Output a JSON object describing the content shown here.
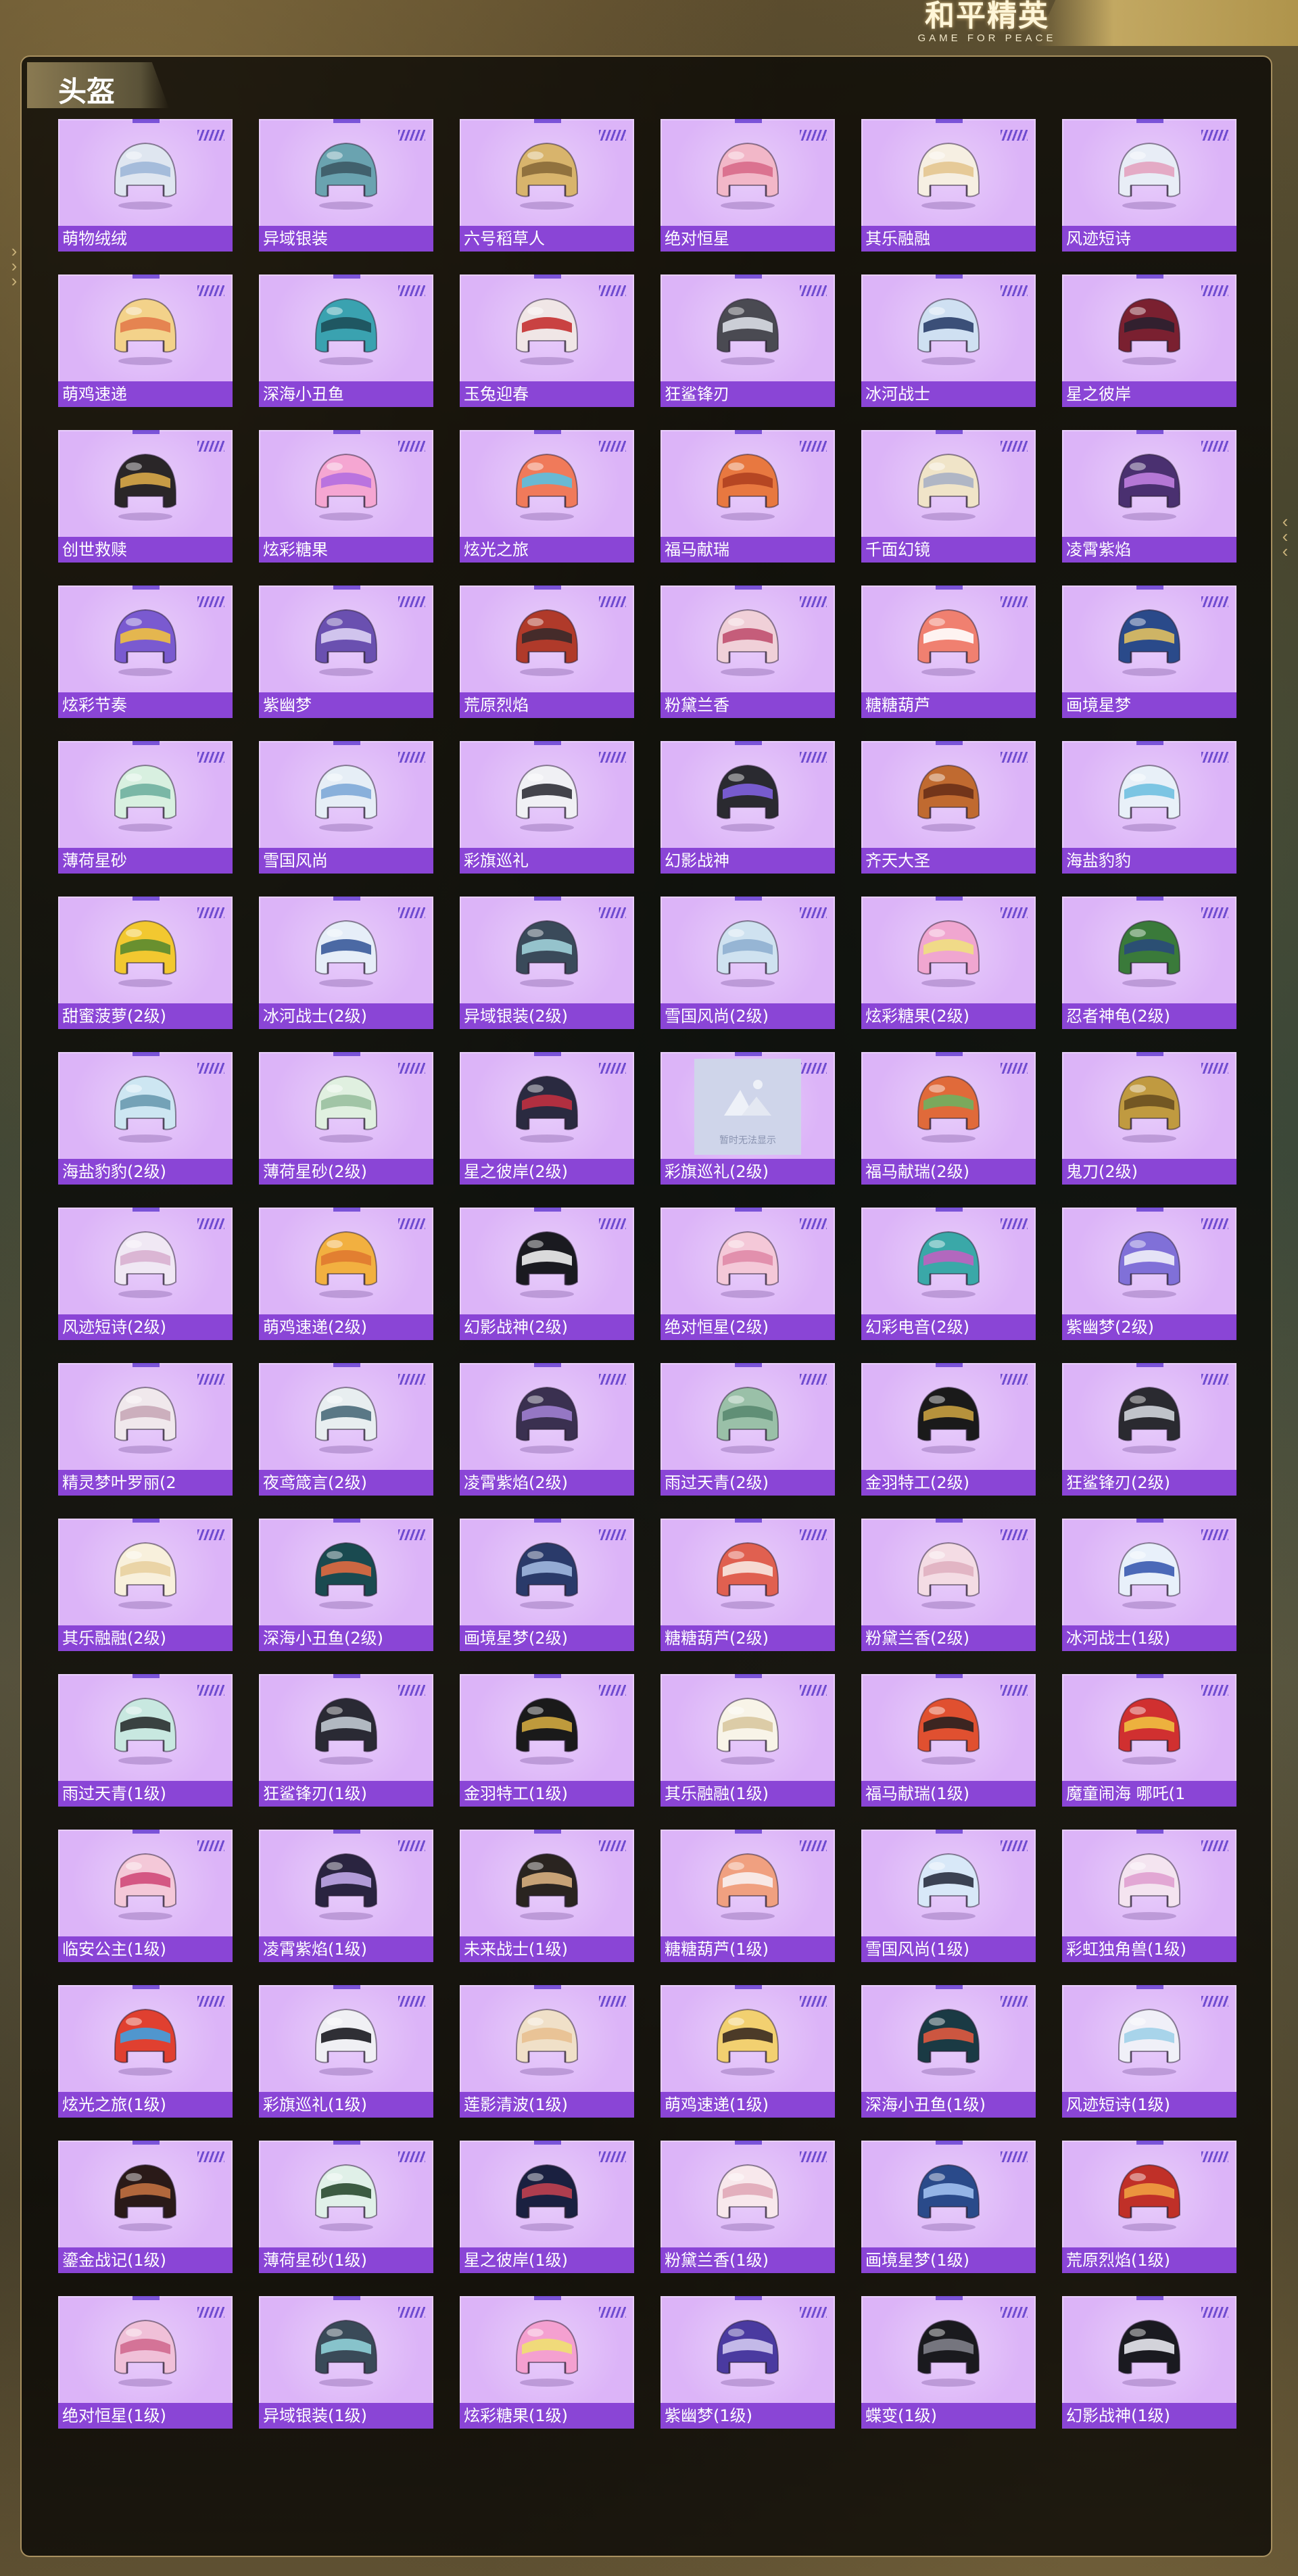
{
  "logo": {
    "title": "和平精英",
    "subtitle": "GAME FOR PEACE"
  },
  "panel": {
    "title": "头盔"
  },
  "placeholder_text": "暂时无法显示",
  "items": [
    {
      "name": "萌物绒绒",
      "color": "#dfe6f0",
      "accent": "#9fb7d8"
    },
    {
      "name": "异域银装",
      "color": "#6aa3b0",
      "accent": "#3d5a66"
    },
    {
      "name": "六号稻草人",
      "color": "#d8b46c",
      "accent": "#8a6a3a"
    },
    {
      "name": "绝对恒星",
      "color": "#f2b7c8",
      "accent": "#d86a8a"
    },
    {
      "name": "其乐融融",
      "color": "#f6efe2",
      "accent": "#e4c590"
    },
    {
      "name": "风迹短诗",
      "color": "#e8edf6",
      "accent": "#e3a2c0"
    },
    {
      "name": "萌鸡速递",
      "color": "#f3d28a",
      "accent": "#e37b4a"
    },
    {
      "name": "深海小丑鱼",
      "color": "#3aa2b0",
      "accent": "#1d4f5a"
    },
    {
      "name": "玉兔迎春",
      "color": "#f0e6e6",
      "accent": "#c43030"
    },
    {
      "name": "狂鲨锋刃",
      "color": "#4a4a52",
      "accent": "#d9dde4"
    },
    {
      "name": "冰河战士",
      "color": "#cfe0f2",
      "accent": "#2a3f6a"
    },
    {
      "name": "星之彼岸",
      "color": "#7a2030",
      "accent": "#2a2030"
    },
    {
      "name": "创世救赎",
      "color": "#2a2628",
      "accent": "#d8a848"
    },
    {
      "name": "炫彩糖果",
      "color": "#f5a6d2",
      "accent": "#b46ee0"
    },
    {
      "name": "炫光之旅",
      "color": "#f07a5a",
      "accent": "#5ac0e0"
    },
    {
      "name": "福马献瑞",
      "color": "#e87840",
      "accent": "#b04020"
    },
    {
      "name": "千面幻镜",
      "color": "#f0e4c8",
      "accent": "#a8b0c4"
    },
    {
      "name": "凌霄紫焰",
      "color": "#4a3070",
      "accent": "#c080e0"
    },
    {
      "name": "炫彩节奏",
      "color": "#7a5ad0",
      "accent": "#f0c040"
    },
    {
      "name": "紫幽梦",
      "color": "#6a50b0",
      "accent": "#dcd0f4"
    },
    {
      "name": "荒原烈焰",
      "color": "#b03a2a",
      "accent": "#3a2a2a"
    },
    {
      "name": "粉黛兰香",
      "color": "#f0d0d8",
      "accent": "#c05070"
    },
    {
      "name": "糖糖葫芦",
      "color": "#f08070",
      "accent": "#ffffff"
    },
    {
      "name": "画境星梦",
      "color": "#2a4a8a",
      "accent": "#e0c060"
    },
    {
      "name": "薄荷星砂",
      "color": "#d8f0e0",
      "accent": "#70b0a0"
    },
    {
      "name": "雪国风尚",
      "color": "#e6eef6",
      "accent": "#7ea8d8"
    },
    {
      "name": "彩旗巡礼",
      "color": "#f0f0f4",
      "accent": "#303038"
    },
    {
      "name": "幻影战神",
      "color": "#2a2a30",
      "accent": "#8060e0"
    },
    {
      "name": "齐天大圣",
      "color": "#c06a30",
      "accent": "#6a3018"
    },
    {
      "name": "海盐豹豹",
      "color": "#e8f0f8",
      "accent": "#70c0e0"
    },
    {
      "name": "甜蜜菠萝(2级)",
      "color": "#f2c830",
      "accent": "#5a8a30"
    },
    {
      "name": "冰河战士(2级)",
      "color": "#e6eef8",
      "accent": "#3a5a9a"
    },
    {
      "name": "异域银装(2级)",
      "color": "#3a4a5a",
      "accent": "#a0d0d8"
    },
    {
      "name": "雪国风尚(2级)",
      "color": "#cfe2f0",
      "accent": "#8fb0d0"
    },
    {
      "name": "炫彩糖果(2级)",
      "color": "#f0a6d0",
      "accent": "#f0e080"
    },
    {
      "name": "忍者神龟(2级)",
      "color": "#3a7a3a",
      "accent": "#2a4a7a"
    },
    {
      "name": "海盐豹豹(2级)",
      "color": "#cde6f2",
      "accent": "#6a9ab0"
    },
    {
      "name": "薄荷星砂(2级)",
      "color": "#e0f0e0",
      "accent": "#9ac0a0"
    },
    {
      "name": "星之彼岸(2级)",
      "color": "#2a2a40",
      "accent": "#c03040"
    },
    {
      "name": "彩旗巡礼(2级)",
      "color": "",
      "accent": "",
      "placeholder": true
    },
    {
      "name": "福马献瑞(2级)",
      "color": "#e06a3a",
      "accent": "#70b060"
    },
    {
      "name": "鬼刀(2级)",
      "color": "#c09a40",
      "accent": "#6a5020"
    },
    {
      "name": "风迹短诗(2级)",
      "color": "#f0e8f4",
      "accent": "#d8b0d0"
    },
    {
      "name": "萌鸡速递(2级)",
      "color": "#f2b040",
      "accent": "#e07a30"
    },
    {
      "name": "幻影战神(2级)",
      "color": "#1a1a20",
      "accent": "#f0f0f0"
    },
    {
      "name": "绝对恒星(2级)",
      "color": "#f4c8d8",
      "accent": "#e08aa8"
    },
    {
      "name": "幻彩电音(2级)",
      "color": "#3aa8a8",
      "accent": "#c060c0"
    },
    {
      "name": "紫幽梦(2级)",
      "color": "#8070d8",
      "accent": "#f0f0fa"
    },
    {
      "name": "精灵梦叶罗丽(2",
      "color": "#f0e8ec",
      "accent": "#c8a8b8"
    },
    {
      "name": "夜鸢箴言(2级)",
      "color": "#e8eef0",
      "accent": "#4a6a7a"
    },
    {
      "name": "凌霄紫焰(2级)",
      "color": "#3a3050",
      "accent": "#a080d0"
    },
    {
      "name": "雨过天青(2级)",
      "color": "#9ac0a8",
      "accent": "#5a8a70"
    },
    {
      "name": "金羽特工(2级)",
      "color": "#1a1a1a",
      "accent": "#c8a040"
    },
    {
      "name": "狂鲨锋刃(2级)",
      "color": "#2a2a30",
      "accent": "#d0d4dc"
    },
    {
      "name": "其乐融融(2级)",
      "color": "#f8f0dc",
      "accent": "#e8d0a0"
    },
    {
      "name": "深海小丑鱼(2级)",
      "color": "#1a4a50",
      "accent": "#e06a40"
    },
    {
      "name": "画境星梦(2级)",
      "color": "#2a3a6a",
      "accent": "#a0b8e0"
    },
    {
      "name": "糖糖葫芦(2级)",
      "color": "#e06050",
      "accent": "#f8e8e0"
    },
    {
      "name": "粉黛兰香(2级)",
      "color": "#f4dce4",
      "accent": "#e0b0c0"
    },
    {
      "name": "冰河战士(1级)",
      "color": "#e8f0fa",
      "accent": "#3a5ab0"
    },
    {
      "name": "雨过天青(1级)",
      "color": "#c8e8e0",
      "accent": "#2a3030"
    },
    {
      "name": "狂鲨锋刃(1级)",
      "color": "#2a2a34",
      "accent": "#c0c8d0"
    },
    {
      "name": "金羽特工(1级)",
      "color": "#1a1a1a",
      "accent": "#d0a840"
    },
    {
      "name": "其乐融融(1级)",
      "color": "#f8f4e8",
      "accent": "#d8c8a0"
    },
    {
      "name": "福马献瑞(1级)",
      "color": "#e05030",
      "accent": "#2a2020"
    },
    {
      "name": "魔童闹海 哪吒(1",
      "color": "#d03030",
      "accent": "#f0c040"
    },
    {
      "name": "临安公主(1级)",
      "color": "#f4c8d8",
      "accent": "#d04a7a"
    },
    {
      "name": "凌霄紫焰(1级)",
      "color": "#2a2440",
      "accent": "#c0a8e8"
    },
    {
      "name": "未来战士(1级)",
      "color": "#2a2420",
      "accent": "#d8b080"
    },
    {
      "name": "糖糖葫芦(1级)",
      "color": "#f0a080",
      "accent": "#f8f0f0"
    },
    {
      "name": "雪国风尚(1级)",
      "color": "#d8e8f8",
      "accent": "#2a3040"
    },
    {
      "name": "彩虹独角兽(1级)",
      "color": "#f4e4f0",
      "accent": "#e0a0d0"
    },
    {
      "name": "炫光之旅(1级)",
      "color": "#e04030",
      "accent": "#40a0e0"
    },
    {
      "name": "彩旗巡礼(1级)",
      "color": "#f0f0f4",
      "accent": "#1a1a20"
    },
    {
      "name": "莲影清波(1级)",
      "color": "#f0e0c8",
      "accent": "#e8c090"
    },
    {
      "name": "萌鸡速递(1级)",
      "color": "#f2d070",
      "accent": "#3a2a20"
    },
    {
      "name": "深海小丑鱼(1级)",
      "color": "#1a3a44",
      "accent": "#e05a40"
    },
    {
      "name": "风迹短诗(1级)",
      "color": "#f0f0f8",
      "accent": "#a0d0e8"
    },
    {
      "name": "鎏金战记(1级)",
      "color": "#2a1a18",
      "accent": "#c07040"
    },
    {
      "name": "薄荷星砂(1级)",
      "color": "#e0f0e8",
      "accent": "#2a4a30"
    },
    {
      "name": "星之彼岸(1级)",
      "color": "#1a2040",
      "accent": "#c04050"
    },
    {
      "name": "粉黛兰香(1级)",
      "color": "#f8e8ec",
      "accent": "#e0a8b8"
    },
    {
      "name": "画境星梦(1级)",
      "color": "#2a4a8a",
      "accent": "#a0c0f0"
    },
    {
      "name": "荒原烈焰(1级)",
      "color": "#c03028",
      "accent": "#f0a040"
    },
    {
      "name": "绝对恒星(1级)",
      "color": "#f0c0d8",
      "accent": "#d06a90"
    },
    {
      "name": "异域银装(1级)",
      "color": "#3a4a58",
      "accent": "#90d0d8"
    },
    {
      "name": "炫彩糖果(1级)",
      "color": "#f4a0d0",
      "accent": "#f0e070"
    },
    {
      "name": "紫幽梦(1级)",
      "color": "#4a3aa0",
      "accent": "#d0c8f0"
    },
    {
      "name": "蝶变(1级)",
      "color": "#1a1a1e",
      "accent": "#808088"
    },
    {
      "name": "幻影战神(1级)",
      "color": "#1a1a20",
      "accent": "#e8e8ee"
    }
  ]
}
